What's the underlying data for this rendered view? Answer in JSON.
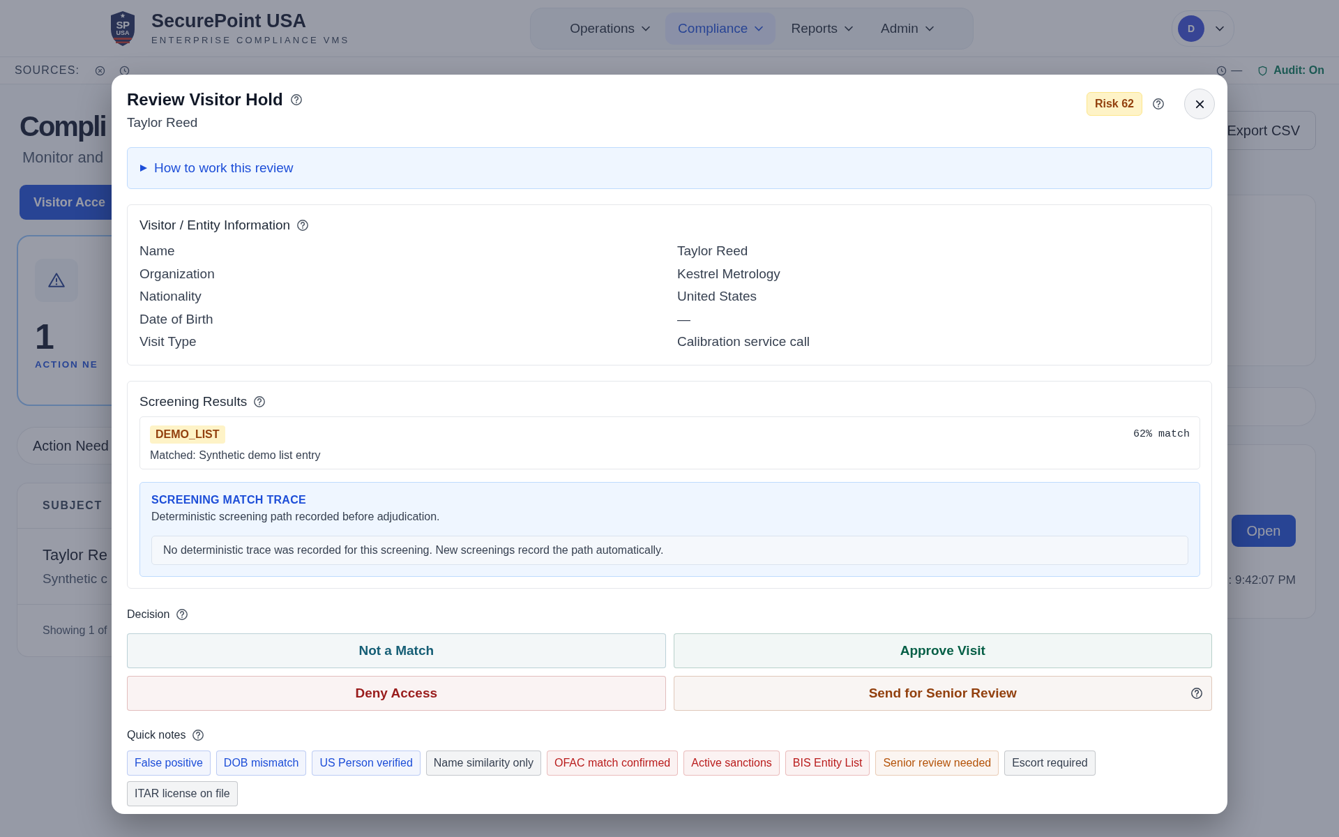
{
  "header": {
    "brand": "SecurePoint USA",
    "tagline": "ENTERPRISE COMPLIANCE VMS",
    "logo_text": "SP",
    "logo_sub": "USA",
    "nav": [
      {
        "label": "Operations",
        "selected": false
      },
      {
        "label": "Compliance",
        "selected": true
      },
      {
        "label": "Reports",
        "selected": false
      },
      {
        "label": "Admin",
        "selected": false
      }
    ],
    "avatar": "D"
  },
  "sources_bar": {
    "label": "SOURCES:",
    "sources": [
      {
        "kind": "error"
      },
      {
        "kind": "pending"
      }
    ],
    "last_sync": "—",
    "audit": "Audit: On"
  },
  "background_page": {
    "title": "Compli",
    "subtitle": "Monitor and",
    "tab": "Visitor Acce",
    "stat_value": "1",
    "stat_label": "ACTION NE",
    "filter_label": "Action Need",
    "column_1": "SUBJECT",
    "row_name": "Taylor Re",
    "row_detail": "Synthetic c",
    "footer": "Showing 1 of",
    "export_button": "Export CSV",
    "open_button": "Open",
    "updated": ": 9:42:07 PM"
  },
  "modal": {
    "title": "Review Visitor Hold",
    "subtitle": "Taylor Reed",
    "risk": "Risk 62",
    "guide": {
      "label": "How to work this review",
      "expanded": false
    },
    "info": {
      "title": "Visitor / Entity Information",
      "fields": [
        {
          "label": "Name",
          "value": "Taylor Reed"
        },
        {
          "label": "Organization",
          "value": "Kestrel Metrology"
        },
        {
          "label": "Nationality",
          "value": "United States"
        },
        {
          "label": "Date of Birth",
          "value": "—"
        },
        {
          "label": "Visit Type",
          "value": "Calibration service call"
        }
      ]
    },
    "screening": {
      "title": "Screening Results",
      "hits": [
        {
          "list": "DEMO_LIST",
          "score": "62% match",
          "detail": "Matched: Synthetic demo list entry"
        }
      ],
      "trace": {
        "title": "SCREENING MATCH TRACE",
        "subtitle": "Deterministic screening path recorded before adjudication.",
        "message": "No deterministic trace was recorded for this screening. New screenings record the path automatically."
      }
    },
    "decision": {
      "label": "Decision",
      "options": [
        {
          "label": "Not a Match",
          "color": "#155e75",
          "help": false
        },
        {
          "label": "Approve Visit",
          "color": "#065f46",
          "help": false
        },
        {
          "label": "Deny Access",
          "color": "#991b1b",
          "help": false
        },
        {
          "label": "Send for Senior Review",
          "color": "#92400e",
          "help": true
        }
      ]
    },
    "quick_notes": {
      "label": "Quick notes",
      "notes": [
        {
          "label": "False positive",
          "color": "#1d4ed8"
        },
        {
          "label": "DOB mismatch",
          "color": "#1d4ed8"
        },
        {
          "label": "US Person verified",
          "color": "#1d4ed8"
        },
        {
          "label": "Name similarity only",
          "color": "#374151"
        },
        {
          "label": "OFAC match confirmed",
          "color": "#b91c1c"
        },
        {
          "label": "Active sanctions",
          "color": "#b91c1c"
        },
        {
          "label": "BIS Entity List",
          "color": "#b91c1c"
        },
        {
          "label": "Senior review needed",
          "color": "#b45309"
        },
        {
          "label": "Escort required",
          "color": "#374151"
        },
        {
          "label": "ITAR license on file",
          "color": "#374151"
        }
      ]
    }
  }
}
